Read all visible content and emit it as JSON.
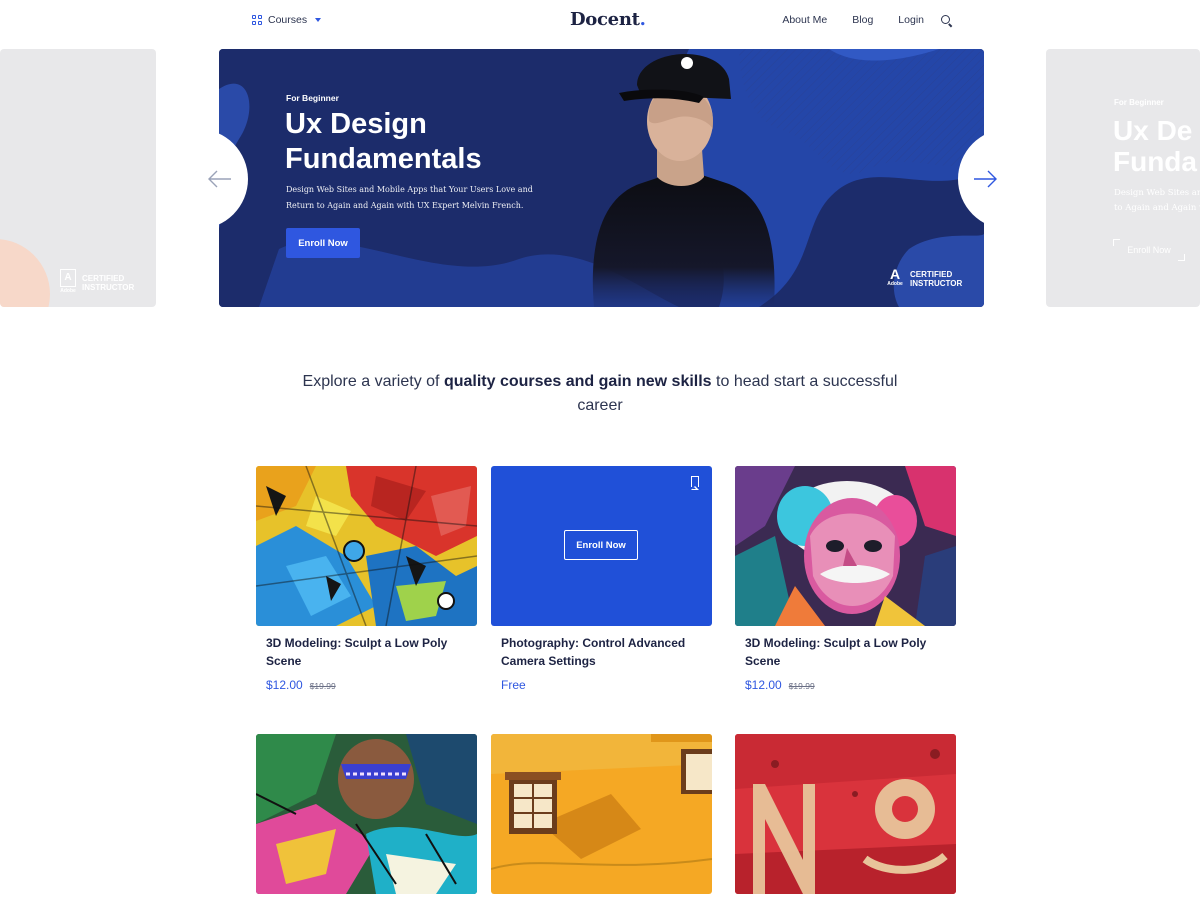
{
  "header": {
    "courses_label": "Courses",
    "logo_text": "Docent",
    "logo_dot": ".",
    "nav": [
      "About Me",
      "Blog",
      "Login"
    ]
  },
  "hero": {
    "kicker": "For Beginner",
    "title": "Ux Design Fundamentals",
    "description": "Design Web Sites and Mobile Apps that Your Users Love and Return to Again and Again with UX Expert Melvin French.",
    "button_label": "Enroll Now",
    "badge_brand": "Adobe",
    "badge_line1": "CERTIFIED",
    "badge_line2": "INSTRUCTOR"
  },
  "ghost_next": {
    "kicker": "For Beginner",
    "title_line1": "Ux De",
    "title_line2": "Funda",
    "desc_line1": "Design Web Sites and",
    "desc_line2": "to Again and Again w",
    "button_label": "Enroll Now"
  },
  "ghost_prev": {
    "badge_line1": "CERTIFIED",
    "badge_line2": "INSTRUCTOR",
    "badge_brand": "Adobe"
  },
  "intro": {
    "before": "Explore a variety of ",
    "bold": "quality courses and gain new skills",
    "after": " to head start a successful career"
  },
  "courses": [
    {
      "title": "3D Modeling: Sculpt a Low Poly Scene",
      "price": "$12.00",
      "old_price": "$19.99",
      "image": "graffiti-birds"
    },
    {
      "title": "Photography: Control Advanced Camera Settings",
      "price": "Free",
      "old_price": "",
      "image": "blue-hover",
      "overlay_button": "Enroll Now"
    },
    {
      "title": "3D Modeling: Sculpt a Low Poly Scene",
      "price": "$12.00",
      "old_price": "$19.99",
      "image": "einstein-mural"
    },
    {
      "title": "",
      "price": "",
      "old_price": "",
      "image": "street-art-face"
    },
    {
      "title": "",
      "price": "",
      "old_price": "",
      "image": "yellow-wall-window"
    },
    {
      "title": "",
      "price": "",
      "old_price": "",
      "image": "red-no-sign"
    }
  ],
  "colors": {
    "accent": "#2f57e0",
    "hero_bg": "#1c2c6b",
    "text_dark": "#1d2343"
  }
}
